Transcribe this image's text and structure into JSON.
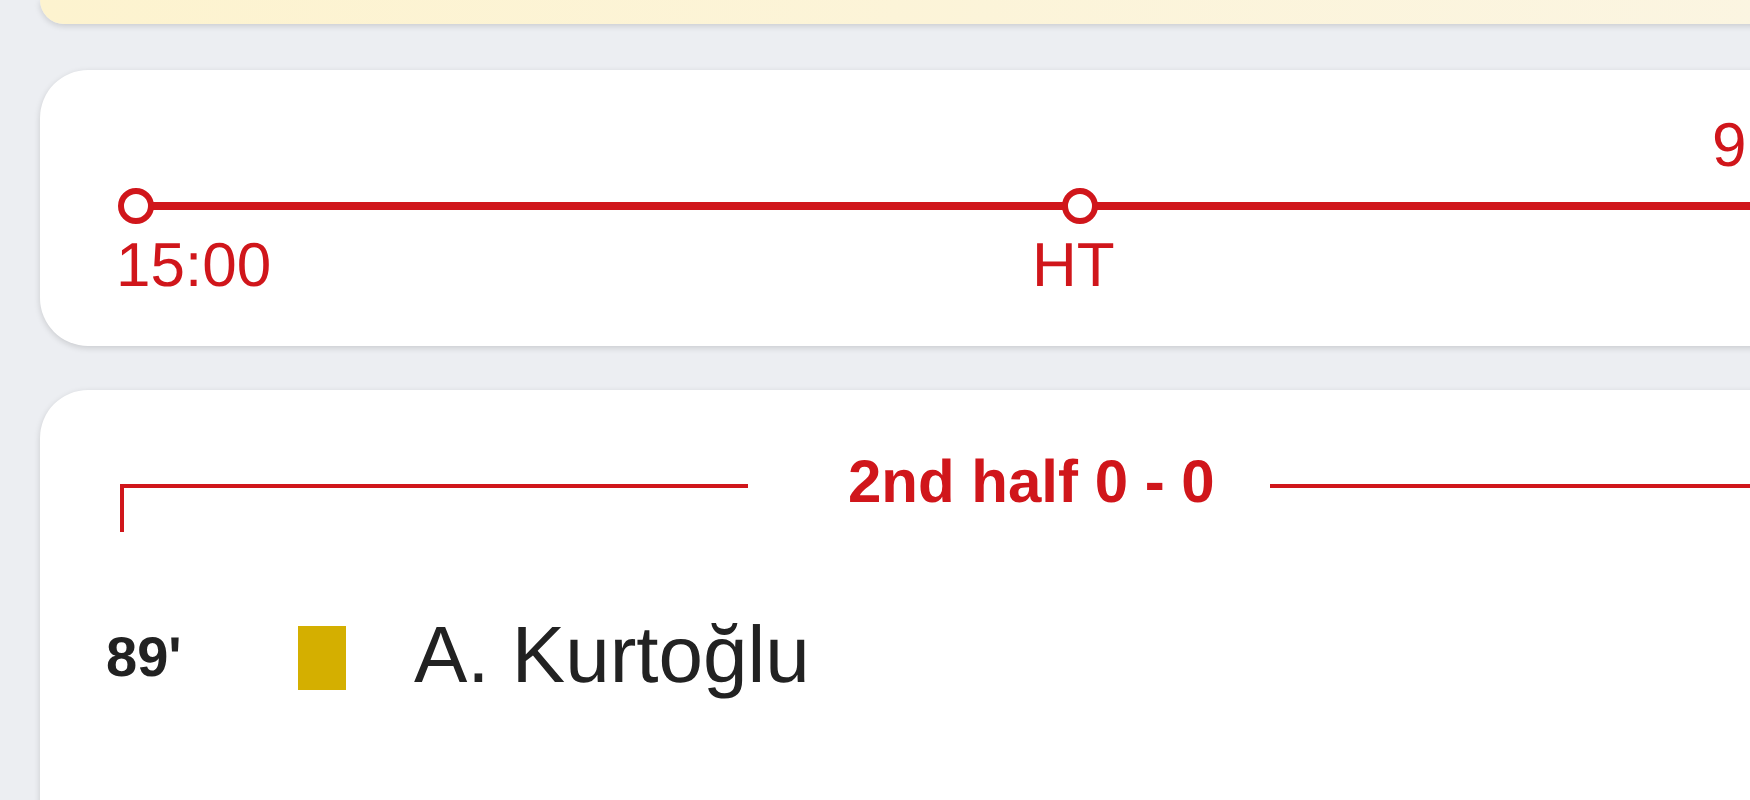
{
  "timeline": {
    "markers": [
      {
        "label": "15:00",
        "kind": "start"
      },
      {
        "label": "HT",
        "kind": "half"
      }
    ],
    "end_label": "9"
  },
  "period": {
    "title": "2nd half 0 - 0"
  },
  "events": [
    {
      "minute": "89'",
      "kind": "yellow-card",
      "player": "A. Kurtoğlu"
    }
  ]
}
